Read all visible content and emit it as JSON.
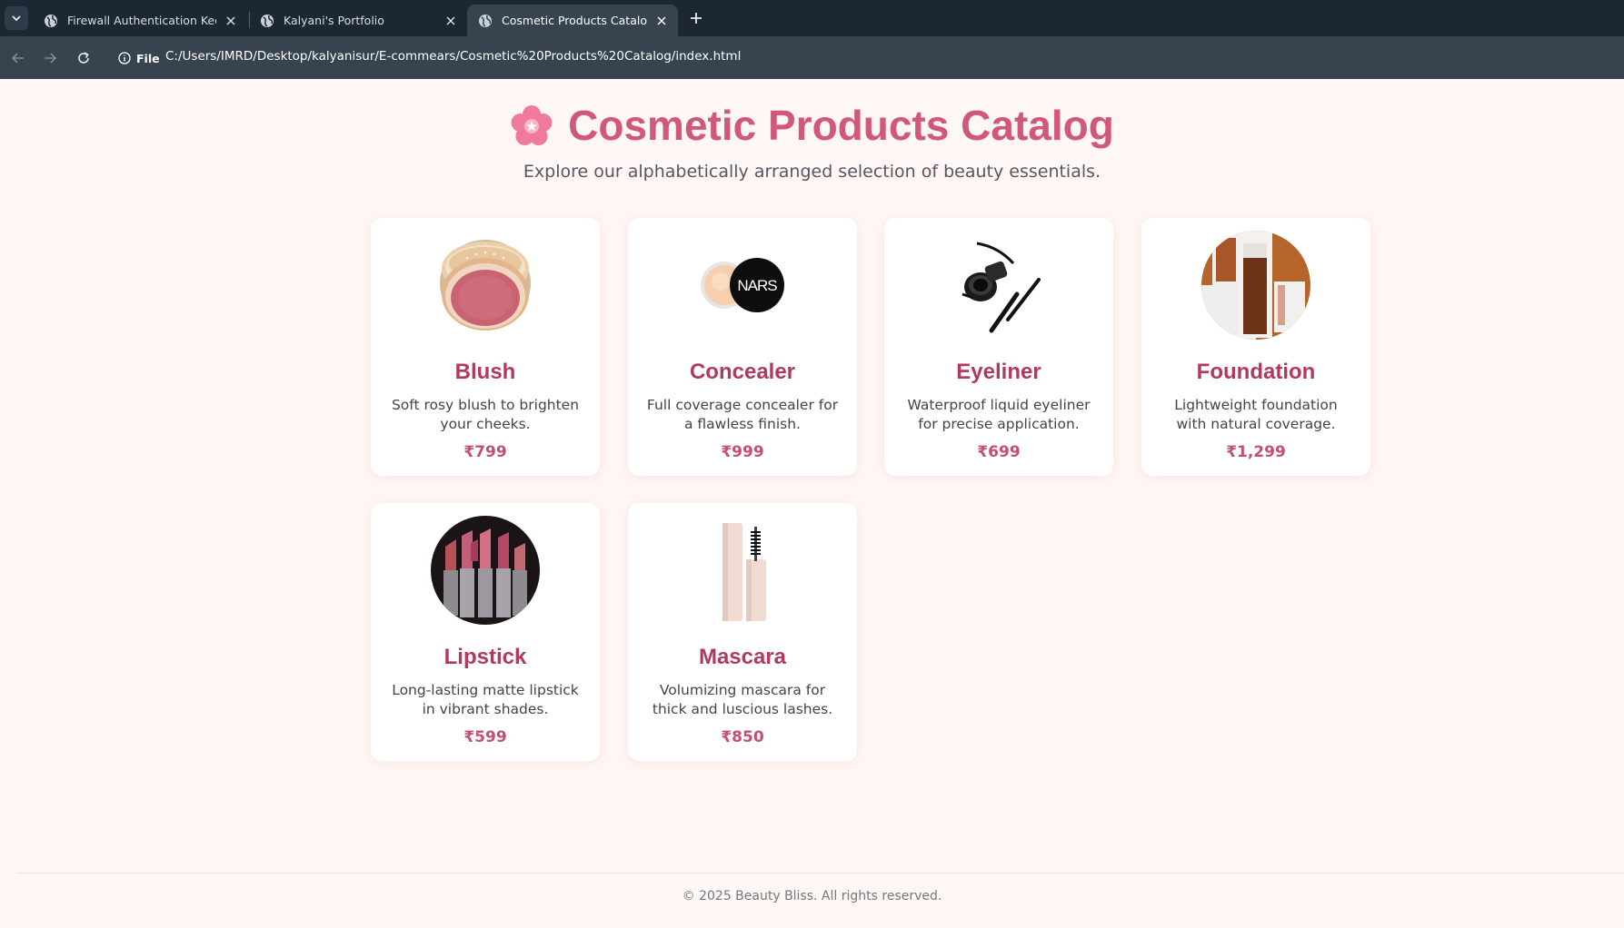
{
  "browser": {
    "tabs": [
      {
        "title": "Firewall Authentication Keepalive",
        "active": false
      },
      {
        "title": "Kalyani's Portfolio",
        "active": false
      },
      {
        "title": "Cosmetic Products Catalog",
        "active": true
      }
    ],
    "site_info_label": "File",
    "url": "C:/Users/IMRD/Desktop/kalyanisur/E-commears/Cosmetic%20Products%20Catalog/index.html"
  },
  "header": {
    "emoji": "🌸",
    "title": "Cosmetic Products Catalog",
    "subtitle": "Explore our alphabetically arranged selection of beauty essentials."
  },
  "products": [
    {
      "name": "Blush",
      "description": "Soft rosy blush to brighten your cheeks.",
      "price": "₹799",
      "image": "blush-compact-image"
    },
    {
      "name": "Concealer",
      "description": "Full coverage concealer for a flawless finish.",
      "price": "₹999",
      "image": "concealer-jar-image"
    },
    {
      "name": "Eyeliner",
      "description": "Waterproof liquid eyeliner for precise application.",
      "price": "₹699",
      "image": "eyeliner-pot-image"
    },
    {
      "name": "Foundation",
      "description": "Lightweight foundation with natural coverage.",
      "price": "₹1,299",
      "image": "foundation-bottle-image"
    },
    {
      "name": "Lipstick",
      "description": "Long-lasting matte lipstick in vibrant shades.",
      "price": "₹599",
      "image": "lipstick-set-image"
    },
    {
      "name": "Mascara",
      "description": "Volumizing mascara for thick and luscious lashes.",
      "price": "₹850",
      "image": "mascara-tube-image"
    }
  ],
  "footer": {
    "text": "© 2025 Beauty Bliss. All rights reserved."
  },
  "colors": {
    "page_background": "#fff7f5",
    "title": "#d0587a",
    "product_name": "#b03a5e",
    "price": "#c4506f",
    "chrome_dark": "#1c2733",
    "chrome_toolbar": "#37434f"
  }
}
